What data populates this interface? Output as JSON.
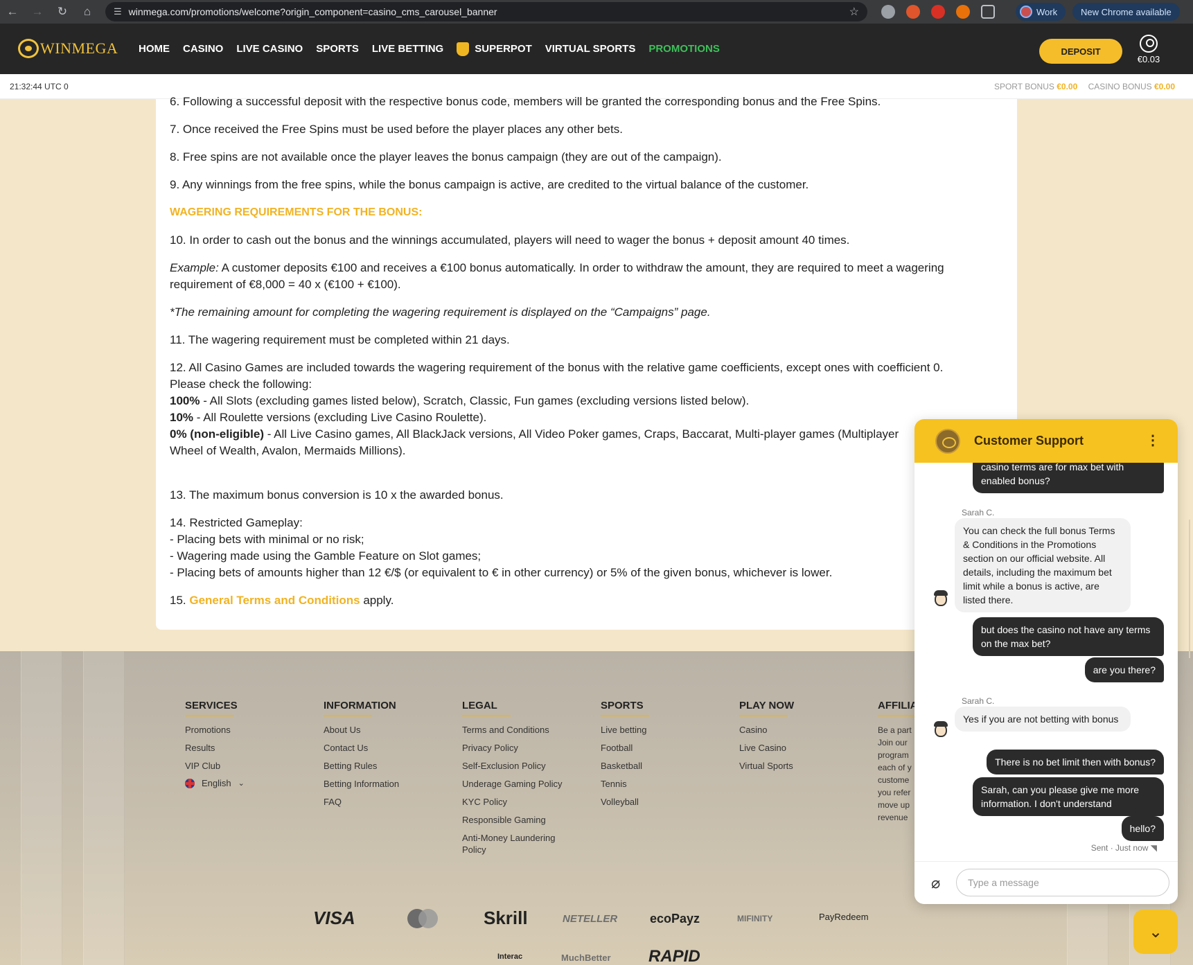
{
  "browser": {
    "url": "winmega.com/promotions/welcome?origin_component=casino_cms_carousel_banner",
    "profile_label": "Work",
    "update_label": "New Chrome available"
  },
  "header": {
    "logo": "WINMEGA",
    "nav": [
      {
        "label": "HOME"
      },
      {
        "label": "CASINO"
      },
      {
        "label": "LIVE CASINO"
      },
      {
        "label": "SPORTS"
      },
      {
        "label": "LIVE BETTING"
      },
      {
        "label": "SUPERPOT"
      },
      {
        "label": "VIRTUAL SPORTS"
      },
      {
        "label": "PROMOTIONS"
      }
    ],
    "deposit_label": "DEPOSIT",
    "balance": "€0.03"
  },
  "status": {
    "time": "21:32:44 UTC 0",
    "sport_bonus_label": "SPORT BONUS",
    "sport_bonus_value": "€0.00",
    "casino_bonus_label": "CASINO BONUS",
    "casino_bonus_value": "€0.00"
  },
  "terms": {
    "t6": "6. Following a successful deposit with the respective bonus code, members will be granted the corresponding bonus and the Free Spins.",
    "t7": "7. Once received the Free Spins must be used before the player places any other bets.",
    "t8": "8. Free spins are not available once the player leaves the bonus campaign (they are out of the campaign).",
    "t9": "9. Any winnings from the free spins, while the bonus campaign is active, are credited to the virtual balance of the customer.",
    "wagering_heading": "WAGERING REQUIREMENTS FOR THE BONUS:",
    "t10": "10. In order to cash out the bonus and the winnings accumulated, players will need to wager the bonus + deposit amount 40 times.",
    "example_label": "Example:",
    "example_text": " A customer deposits €100 and receives a €100 bonus automatically. In order to withdraw the amount, they are required to meet a wagering requirement of €8,000 = 40 x (€100 + €100).",
    "remaining_note": "*The remaining amount for completing the wagering requirement is displayed on the “Campaigns” page.",
    "t11": "11. The wagering requirement must be completed within 21 days.",
    "t12_line1": "12. All Casino Games are included towards the wagering requirement of the bonus with the relative game coefficients, except ones with coefficient 0.",
    "t12_check": "Please check the following:",
    "coef100_label": "100%",
    "coef100_text": " - All Slots (excluding games listed below), Scratch, Classic, Fun games (excluding versions listed below).",
    "coef10_label": "10%",
    "coef10_text": " - All Roulette versions (excluding Live Casino Roulette).",
    "coef0_label": "0% (non-eligible)",
    "coef0_text": " - All Live Casino games, All BlackJack versions, All Video Poker games, Craps, Baccarat, Multi-player games (Multiplayer",
    "coef0_text2": "Wheel of Wealth, Avalon, Mermaids Millions).",
    "t13": "13. The maximum bonus conversion is 10 x the awarded bonus.",
    "t14_title": "14. Restricted Gameplay:",
    "t14_a": "- Placing bets with minimal or no risk;",
    "t14_b": "- Wagering made using the Gamble Feature on Slot games;",
    "t14_c": "- Placing bets of amounts higher than 12 €/$ (or equivalent to € in other currency) or 5% of the given bonus, whichever is lower.",
    "t15_prefix": "15. ",
    "t15_link": "General Terms and Conditions",
    "t15_suffix": " apply."
  },
  "footer": {
    "services": {
      "title": "SERVICES",
      "links": [
        "Promotions",
        "Results",
        "VIP Club"
      ],
      "language": "English"
    },
    "information": {
      "title": "INFORMATION",
      "links": [
        "About Us",
        "Contact Us",
        "Betting Rules",
        "Betting Information",
        "FAQ"
      ]
    },
    "legal": {
      "title": "LEGAL",
      "links": [
        "Terms and Conditions",
        "Privacy Policy",
        "Self-Exclusion Policy",
        "Underage Gaming Policy",
        "KYC Policy",
        "Responsible Gaming",
        "Anti-Money Laundering Policy"
      ]
    },
    "sports": {
      "title": "SPORTS",
      "links": [
        "Live betting",
        "Football",
        "Basketball",
        "Tennis",
        "Volleyball"
      ]
    },
    "playnow": {
      "title": "PLAY NOW",
      "links": [
        "Casino",
        "Live Casino",
        "Virtual Sports"
      ]
    },
    "affiliates": {
      "title": "AFFILIA",
      "lines": [
        "Be a part",
        "Join our",
        "program",
        "each of y",
        "custome",
        "you refer",
        "move up",
        "revenue"
      ]
    },
    "payments": [
      "VISA",
      "Skrill",
      "NETELLER",
      "ecoPayz",
      "MIFINITY",
      "PayRedeem"
    ],
    "payments_row2": [
      "Interac",
      "MuchBetter",
      "RAPID"
    ]
  },
  "chat": {
    "title": "Customer Support",
    "messages": [
      {
        "from": "user",
        "text": "casino terms are for max bet with enabled bonus?"
      },
      {
        "from": "agent",
        "name": "Sarah C.",
        "text": "You can check the full bonus Terms & Conditions in the Promotions section on our official website. All details, including the maximum bet limit while a bonus is active, are listed there."
      },
      {
        "from": "user",
        "text": "but does the casino not have any terms on the max bet?"
      },
      {
        "from": "user",
        "text": "are you there?"
      },
      {
        "from": "agent",
        "name": "Sarah C.",
        "text": "Yes if you are not betting with bonus"
      },
      {
        "from": "user",
        "text": "There is no bet limit then with bonus?"
      },
      {
        "from": "user",
        "text": "Sarah, can you please give me more information. I don't understand"
      },
      {
        "from": "user",
        "text": "hello?"
      }
    ],
    "sent_status": "Sent · Just now",
    "input_placeholder": "Type a message"
  }
}
